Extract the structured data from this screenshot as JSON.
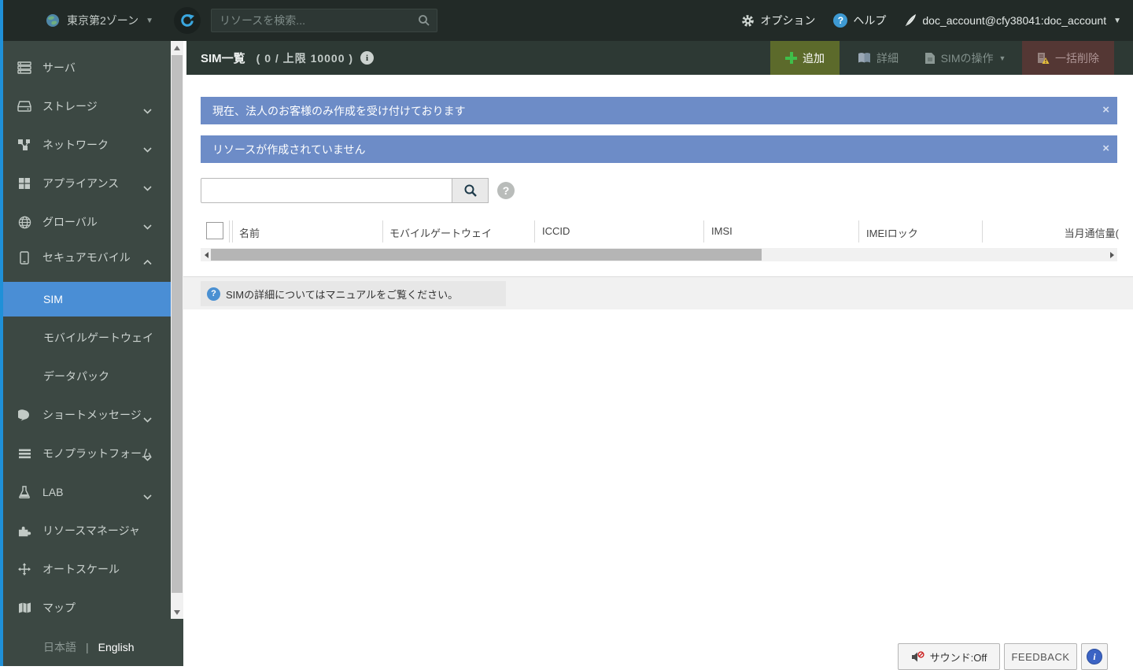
{
  "topbar": {
    "zone_label": "東京第2ゾーン",
    "zone_caret": "▼",
    "search_placeholder": "リソースを検索...",
    "options_label": "オプション",
    "help_label": "ヘルプ",
    "account_label": "doc_account@cfy38041:doc_account",
    "account_caret": "▼"
  },
  "sidebar": {
    "items": [
      {
        "label": "サーバ"
      },
      {
        "label": "ストレージ"
      },
      {
        "label": "ネットワーク"
      },
      {
        "label": "アプライアンス"
      },
      {
        "label": "グローバル"
      },
      {
        "label": "セキュアモバイル"
      },
      {
        "label": "ショートメッセージ"
      },
      {
        "label": "モノプラットフォーム"
      },
      {
        "label": "LAB"
      },
      {
        "label": "リソースマネージャ"
      },
      {
        "label": "オートスケール"
      },
      {
        "label": "マップ"
      }
    ],
    "secure_mobile_children": [
      {
        "label": "SIM"
      },
      {
        "label": "モバイルゲートウェイ"
      },
      {
        "label": "データパック"
      }
    ],
    "language": {
      "ja": "日本語",
      "separator": "|",
      "en": "English"
    }
  },
  "page_header": {
    "title": "SIM一覧",
    "count": "( 0 / 上限 10000 )",
    "buttons": {
      "add": "追加",
      "detail": "詳細",
      "sim_ops": "SIMの操作",
      "sim_ops_caret": "▼",
      "bulk_delete": "一括削除"
    }
  },
  "notifications": [
    {
      "message": "現在、法人のお客様のみ作成を受け付けております",
      "close": "×"
    },
    {
      "message": "リソースが作成されていません",
      "close": "×"
    }
  ],
  "filter": {
    "search_value": "",
    "help": "?"
  },
  "table": {
    "columns": [
      "名前",
      "モバイルゲートウェイ",
      "ICCID",
      "IMSI",
      "IMEIロック",
      "当月通信量("
    ]
  },
  "info_row": {
    "icon": "?",
    "message": "SIMの詳細についてはマニュアルをご覧ください。"
  },
  "footer": {
    "sound_label": "サウンド:Off",
    "feedback_label": "FEEDBACK",
    "info": "i"
  },
  "colors": {
    "accent_blue": "#1f90d8",
    "selected_blue": "#4a8ed5",
    "notice_blue": "#6d8cc7",
    "add_green": "#5c6a2b",
    "delete_red": "#543734",
    "topbar_bg": "#222a27",
    "sidebar_bg": "#3c4843",
    "header_band_bg": "#2d3934"
  }
}
